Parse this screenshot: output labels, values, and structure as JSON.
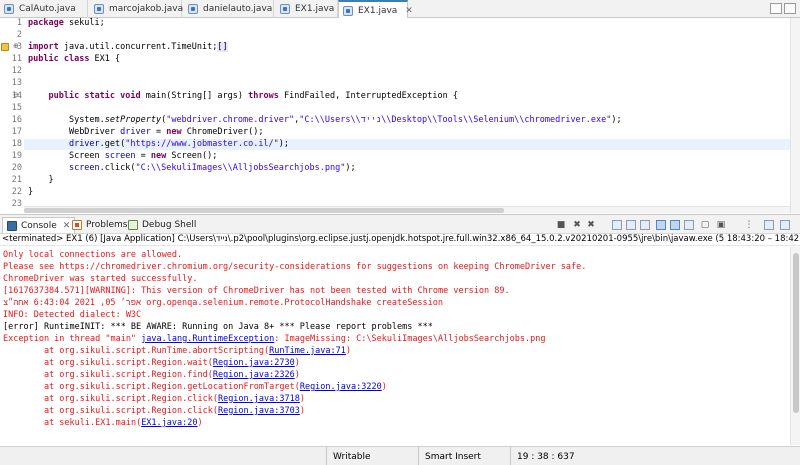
{
  "editor_tabs": [
    {
      "label": "CalAuto.java"
    },
    {
      "label": "marcojakob.java"
    },
    {
      "label": "danielauto.java"
    },
    {
      "label": "EX1.java"
    },
    {
      "label": "EX1.java",
      "active": true,
      "close": "✕"
    }
  ],
  "line_numbers": [
    "1",
    "2",
    "3",
    "11",
    "12",
    "13",
    "14",
    "15",
    "16",
    "17",
    "18",
    "19",
    "20",
    "21",
    "22",
    "23"
  ],
  "code": {
    "l1": {
      "kw": "package",
      "rest": " sekuli;"
    },
    "l3": {
      "kw": "import",
      "rest": " java.util.concurrent.TimeUnit;",
      "box": "[]"
    },
    "l11": {
      "kw1": "public",
      "kw2": "class",
      "rest": " EX1 {"
    },
    "l14": {
      "kw1": "public",
      "kw2": "static",
      "kw3": "void",
      "mid": " main(String[] args) ",
      "kw4": "throws",
      "rest": " FindFailed, InterruptedException {"
    },
    "l16": {
      "pre": "System.",
      "method": "setProperty",
      "open": "(",
      "s1": "\"webdriver.chrome.driver\"",
      "comma": ",",
      "s2": "\"C:\\\\Users\\\\נייד\\\\Desktop\\\\Tools\\\\Selenium\\\\chromedriver.exe\"",
      "close": ");"
    },
    "l17": {
      "pre": "WebDriver ",
      "var": "driver",
      "eq": " = ",
      "kw": "new",
      "rest": " ChromeDriver();"
    },
    "l18": {
      "var": "driver",
      "mid": ".get(",
      "s": "\"https://www.jobmaster.co.il/\"",
      "close": ");"
    },
    "l19": {
      "pre": "Screen ",
      "var": "screen",
      "eq": " = ",
      "kw": "new",
      "rest": " Screen();"
    },
    "l20": {
      "var": "screen",
      "mid": ".click(",
      "s": "\"C:\\\\SekuliImages\\\\AlljobsSearchjobs.png\"",
      "close": ");"
    },
    "l21": "}",
    "l22": "}"
  },
  "console_tabs": {
    "console": "Console",
    "problems": "Problems",
    "debug_shell": "Debug Shell"
  },
  "terminated_line": "<terminated> EX1 (6) [Java Application] C:\\Users\\נייד\\.p2\\pool\\plugins\\org.eclipse.justj.openjdk.hotspot.jre.full.win32.x86_64_15.0.2.v20210201-0955\\jre\\bin\\javaw.exe  (5 18:43:20 – 18:42:59 ,2021 באפר)",
  "console_lines": [
    {
      "text": "Only local connections are allowed.",
      "color": "red"
    },
    {
      "text": "Please see https://chromedriver.chromium.org/security-considerations for suggestions on keeping ChromeDriver safe.",
      "color": "red"
    },
    {
      "text": "ChromeDriver was started successfully.",
      "color": "red"
    },
    {
      "text": "[1617637384.571][WARNING]: This version of ChromeDriver has not been tested with Chrome version 89.",
      "color": "red"
    },
    {
      "text": "אפר׳ 05, 2021 6:43:04 אחה״צ org.openqa.selenium.remote.ProtocolHandshake createSession",
      "color": "red"
    },
    {
      "text": "INFO: Detected dialect: W3C",
      "color": "red"
    },
    {
      "text": "[error] RuntimeINIT: *** BE AWARE: Running on Java 8+ *** Please report problems ***",
      "color": "black"
    }
  ],
  "exception": {
    "prefix": "Exception in thread \"main\" ",
    "link": "java.lang.RuntimeException",
    "suffix": ": ImageMissing: C:\\SekuliImages\\AlljobsSearchjobs.png"
  },
  "stack_trace": [
    {
      "at": "\tat org.sikuli.script.RunTime.abortScripting(",
      "link": "RunTime.java:71",
      "end": ")"
    },
    {
      "at": "\tat org.sikuli.script.Region.wait(",
      "link": "Region.java:2730",
      "end": ")"
    },
    {
      "at": "\tat org.sikuli.script.Region.find(",
      "link": "Region.java:2326",
      "end": ")"
    },
    {
      "at": "\tat org.sikuli.script.Region.getLocationFromTarget(",
      "link": "Region.java:3220",
      "end": ")"
    },
    {
      "at": "\tat org.sikuli.script.Region.click(",
      "link": "Region.java:3718",
      "end": ")"
    },
    {
      "at": "\tat org.sikuli.script.Region.click(",
      "link": "Region.java:3703",
      "end": ")"
    },
    {
      "at": "\tat sekuli.EX1.main(",
      "link": "EX1.java:20",
      "end": ")"
    }
  ],
  "status": {
    "writable": "Writable",
    "insert_mode": "Smart Insert",
    "position": "19 : 38 : 637"
  },
  "colors": {
    "keyword": "#7f0055",
    "string": "#2a00ff",
    "field": "#0000c0",
    "error_text": "#e8181c",
    "link": "#0000ee",
    "active_tab_accent": "#3c7fb1"
  },
  "icons": [
    "java-file-icon",
    "console-icon",
    "problems-icon",
    "debug-shell-icon",
    "warning-icon",
    "clear-console-icon",
    "terminate-icon",
    "pin-icon",
    "scroll-lock-icon",
    "open-console-icon",
    "minimize-icon",
    "maximize-icon"
  ]
}
